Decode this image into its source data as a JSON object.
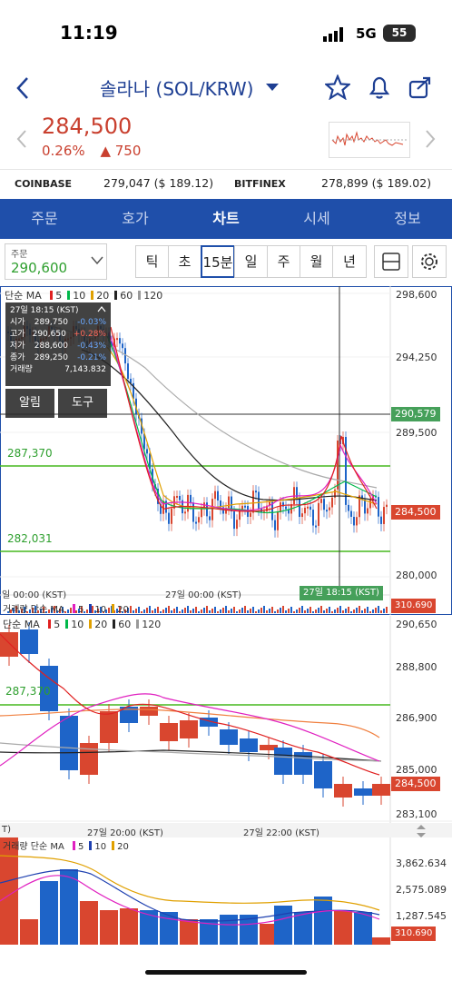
{
  "status_bar": {
    "time": "11:19",
    "network": "5G",
    "battery": "55"
  },
  "header": {
    "title": "솔라나 (SOL/KRW)"
  },
  "ticker": {
    "price": "284,500",
    "change_pct": "0.26%",
    "change_arrow": "▲",
    "change_abs": "750"
  },
  "exchanges": [
    {
      "name": "COINBASE",
      "value": "279,047 ($ 189.12)"
    },
    {
      "name": "BITFINEX",
      "value": "278,899 ($ 189.02)"
    }
  ],
  "tabs": [
    "주문",
    "호가",
    "차트",
    "시세",
    "정보"
  ],
  "active_tab": "차트",
  "order": {
    "label": "주문",
    "value": "290,600"
  },
  "intervals": [
    "틱",
    "초",
    "15분",
    "일",
    "주",
    "월",
    "년"
  ],
  "selected_interval": "15분",
  "main_chart": {
    "legend": {
      "prefix": "단순 MA",
      "items": [
        {
          "label": "5",
          "color": "#e02020"
        },
        {
          "label": "10",
          "color": "#00b84a"
        },
        {
          "label": "20",
          "color": "#e0a000"
        },
        {
          "label": "60",
          "color": "#222222"
        },
        {
          "label": "120",
          "color": "#999999"
        }
      ]
    },
    "y_ticks": [
      "298,600",
      "294,250",
      "289,500",
      "284,500",
      "280,000"
    ],
    "crosshair_price": "290,579",
    "current_price": "284,500",
    "levels": [
      "287,370",
      "282,031"
    ],
    "x_labels": [
      "일 00:00 (KST)",
      "27일 00:00 (KST)"
    ],
    "crosshair_time": "27일 18:15 (KST)",
    "volume_legend": "거래량 단순 MA",
    "volume_legend_items": [
      {
        "label": "5",
        "color": "#e020c0"
      },
      {
        "label": "10",
        "color": "#1e40b0"
      },
      {
        "label": "20",
        "color": "#e0a000"
      }
    ],
    "volume_tag": "310.690"
  },
  "tooltip": {
    "title": "27일 18:15 (KST)",
    "rows": [
      {
        "label": "시가",
        "value": "289,750",
        "pct": "-0.03%",
        "color": "#6aa8ff"
      },
      {
        "label": "고가",
        "value": "290,650",
        "pct": "+0.28%",
        "color": "#ff6a5a"
      },
      {
        "label": "저가",
        "value": "288,600",
        "pct": "-0.43%",
        "color": "#6aa8ff"
      },
      {
        "label": "종가",
        "value": "289,250",
        "pct": "-0.21%",
        "color": "#6aa8ff"
      }
    ],
    "volume_label": "거래량",
    "volume_value": "7,143.832",
    "alert_label": "알림",
    "tools_label": "도구"
  },
  "zoom_chart": {
    "legend": {
      "prefix": "단순 MA",
      "items": [
        {
          "label": "5",
          "color": "#e02020"
        },
        {
          "label": "10",
          "color": "#00b84a"
        },
        {
          "label": "20",
          "color": "#e0a000"
        },
        {
          "label": "60",
          "color": "#222222"
        },
        {
          "label": "120",
          "color": "#999999"
        }
      ]
    },
    "y_ticks": [
      "290,650",
      "288,800",
      "286,900",
      "285,000",
      "283,100"
    ],
    "current_price": "284,500",
    "level": "287,370",
    "x_labels": [
      "T)",
      "27일 20:00 (KST)",
      "27일 22:00 (KST)"
    ]
  },
  "volume_chart": {
    "legend": "거래량 단순 MA",
    "legend_items": [
      {
        "label": "5",
        "color": "#e020c0"
      },
      {
        "label": "10",
        "color": "#1e40b0"
      },
      {
        "label": "20",
        "color": "#e0a000"
      }
    ],
    "y_ticks": [
      "3,862.634",
      "2,575.089",
      "1,287.545"
    ],
    "current": "310.690"
  },
  "colors": {
    "up": "#d9462f",
    "down": "#1e64c8",
    "accent": "#1f4faa",
    "level": "#46b81e"
  }
}
